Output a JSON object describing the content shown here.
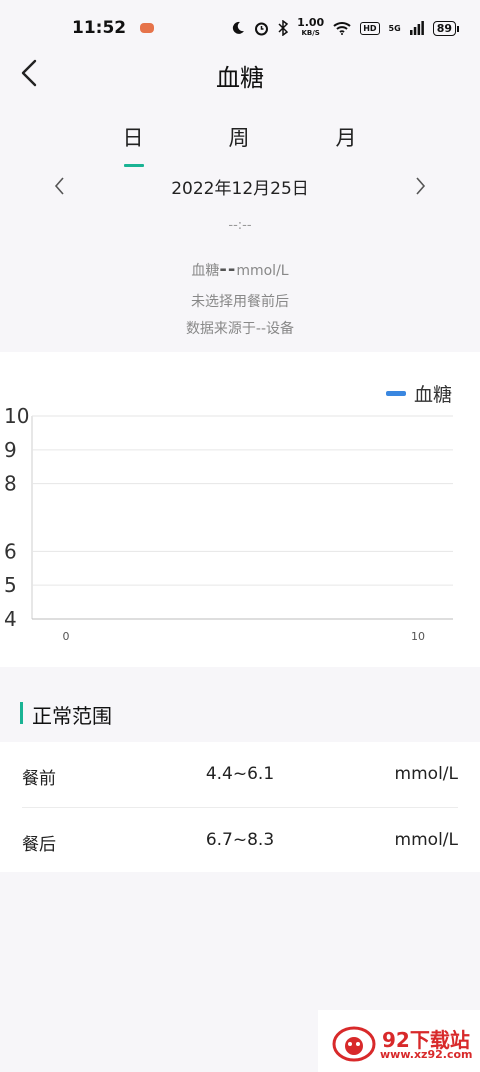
{
  "status_bar": {
    "time": "11:52",
    "speed_value": "1.00",
    "speed_unit": "KB/S",
    "network": "5G",
    "hd": "HD",
    "battery": "89"
  },
  "header": {
    "title": "血糖"
  },
  "tabs": {
    "day": "日",
    "week": "周",
    "month": "月",
    "selected": "日"
  },
  "date": "2022年12月25日",
  "reading": {
    "time": "--:--",
    "label": "血糖",
    "value": "--",
    "unit": "mmol/L",
    "meal_status": "未选择用餐前后",
    "source": "数据来源于--设备"
  },
  "colors": {
    "accent": "#1ab394",
    "series": "#3a87e0"
  },
  "chart_data": {
    "type": "line",
    "series": [
      {
        "name": "血糖",
        "values": []
      }
    ],
    "x": [],
    "xlim": [
      0,
      10
    ],
    "xticks": [
      "0",
      "10"
    ],
    "ylim": [
      4,
      10
    ],
    "yticks": [
      "10",
      "9",
      "8",
      "6",
      "5",
      "4"
    ],
    "grid": true,
    "legend": "top-right"
  },
  "normal_range": {
    "title": "正常范围",
    "rows": [
      {
        "label": "餐前",
        "range": "4.4~6.1",
        "unit": "mmol/L"
      },
      {
        "label": "餐后",
        "range": "6.7~8.3",
        "unit": "mmol/L"
      }
    ]
  },
  "watermark": {
    "title": "92下载站",
    "url": "www.xz92.com"
  }
}
